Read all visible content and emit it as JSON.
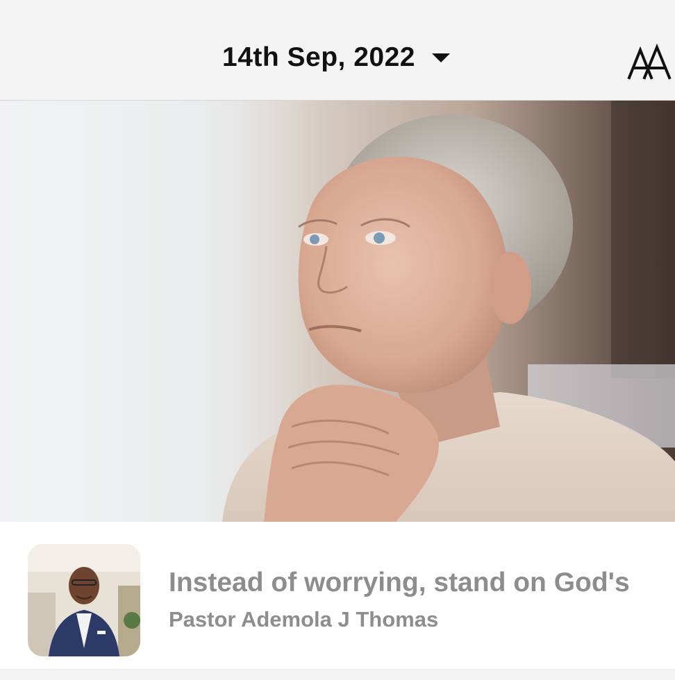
{
  "header": {
    "date_label": "14th Sep, 2022",
    "date_dropdown_icon": "caret-down-icon",
    "font_size_icon": "text-size-icon",
    "font_size_label": "AA"
  },
  "hero": {
    "image_icon": "hero-photo"
  },
  "article": {
    "title": "Instead of worrying, stand on God's",
    "author": "Pastor Ademola J Thomas",
    "thumbnail_icon": "author-photo"
  },
  "colors": {
    "header_bg": "#f4f4f4",
    "text_primary": "#111111",
    "text_secondary": "#8d8d8d"
  }
}
